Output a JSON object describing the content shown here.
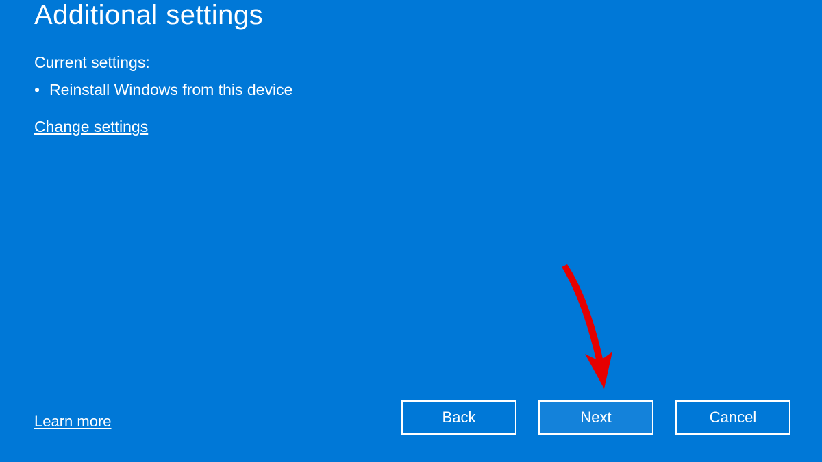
{
  "header": {
    "title": "Additional settings"
  },
  "content": {
    "subheading": "Current settings:",
    "settings_list": [
      "Reinstall Windows from this device"
    ],
    "change_link": "Change settings"
  },
  "footer": {
    "learn_more": "Learn more",
    "buttons": {
      "back": "Back",
      "next": "Next",
      "cancel": "Cancel"
    }
  },
  "annotation": {
    "arrow_color": "#e60000"
  }
}
